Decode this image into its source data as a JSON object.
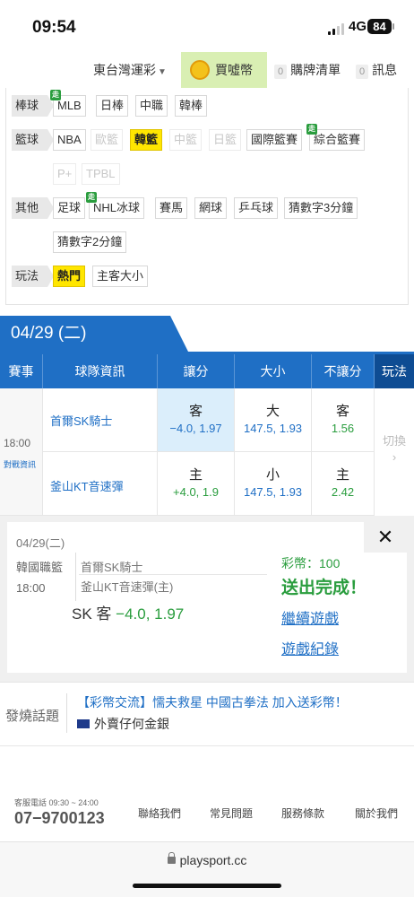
{
  "status": {
    "time": "09:54",
    "network": "4G",
    "battery": "84"
  },
  "nav": {
    "dropdown": "東台灣運彩",
    "buy_label": "買噓幣",
    "purchase_count": "0",
    "purchase_label": "購牌清單",
    "message_count": "0",
    "message_label": "訊息"
  },
  "filter": {
    "rows": [
      {
        "label": "棒球",
        "chips": [
          "MLB",
          "日棒",
          "中職",
          "韓棒"
        ]
      },
      {
        "label": "籃球",
        "chips": [
          "NBA",
          "歐籃",
          "韓籃",
          "中籃",
          "日籃",
          "國際籃賽",
          "綜合籃賽"
        ]
      },
      {
        "label": "",
        "chips": [
          "P+",
          "TPBL"
        ]
      },
      {
        "label": "其他",
        "chips": [
          "足球",
          "NHL冰球",
          "賽馬",
          "網球",
          "乒乓球",
          "猜數字3分鐘"
        ]
      },
      {
        "label": "",
        "chips": [
          "猜數字2分鐘"
        ]
      },
      {
        "label": "玩法",
        "chips": [
          "熱門",
          "主客大小"
        ]
      }
    ],
    "walk_badge": "走"
  },
  "date_tab": "04/29 (二)",
  "table": {
    "headers": [
      "賽事",
      "球隊資訊",
      "讓分",
      "大小",
      "不讓分",
      "玩法"
    ],
    "game": {
      "time": "18:00",
      "info_link": "對戰資訊",
      "away_team": "首爾SK騎士",
      "home_team": "釜山KT音速彈",
      "away": {
        "spread_k": "客",
        "spread": "−4.0, 1.97",
        "total_k": "大",
        "total": "147.5, 1.93",
        "ml_k": "客",
        "ml": "1.56"
      },
      "home": {
        "spread_k": "主",
        "spread": "+4.0, 1.9",
        "total_k": "小",
        "total": "147.5, 1.93",
        "ml_k": "主",
        "ml": "2.42"
      },
      "switch_label": "切換",
      "switch_arrow": "›"
    }
  },
  "popup": {
    "date": "04/29(二)",
    "league": "韓國職籃",
    "time": "18:00",
    "team1": "首爾SK騎士",
    "team2": "釜山KT音速彈(主)",
    "pick_prefix": "SK 客",
    "pick_value": "−4.0, 1.97",
    "close": "✕",
    "coins": "彩幣：100",
    "sent": "送出完成！",
    "continue": "繼續遊戲",
    "history": "遊戲紀錄"
  },
  "hot": {
    "label": "發燒話題",
    "topic1": "【彩幣交流】懦夫救星 中國古拳法 加入送彩幣！",
    "topic2": "外賣仔何金銀"
  },
  "footer": {
    "hotline_label": "客服電話 09:30 ~ 24:00",
    "phone": "07−9700123",
    "links": [
      "聯絡我們",
      "常見問題",
      "服務條款",
      "關於我們"
    ]
  },
  "browser": {
    "url": "playsport.cc"
  },
  "colors": {
    "accent": "#1f6fc5",
    "selected": "#ffe600",
    "positive": "#2a9d3e"
  }
}
